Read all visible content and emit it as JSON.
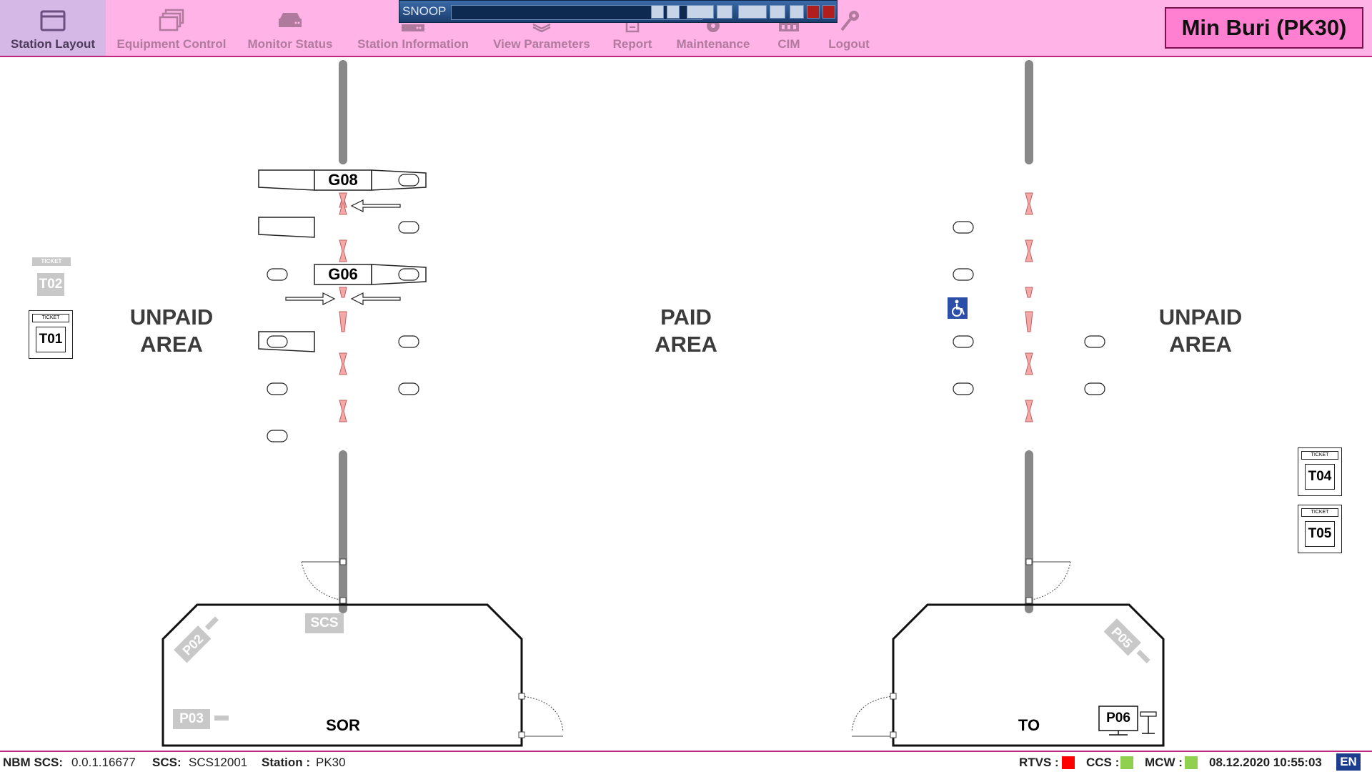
{
  "toolbar": {
    "items": [
      {
        "label": "Station Layout",
        "icon": "window-icon",
        "active": true
      },
      {
        "label": "Equipment Control",
        "icon": "windows-stack-icon"
      },
      {
        "label": "Monitor Status",
        "icon": "server-icon"
      },
      {
        "label": "Station Information",
        "icon": "info-server-icon"
      },
      {
        "label": "View Parameters",
        "icon": "layers-icon"
      },
      {
        "label": "Report",
        "icon": "document-icon"
      },
      {
        "label": "Maintenance",
        "icon": "gear-icon"
      },
      {
        "label": "CIM",
        "icon": "cim-icon"
      },
      {
        "label": "Logout",
        "icon": "key-icon"
      }
    ],
    "station_name": "Min Buri (PK30)"
  },
  "snoop": {
    "title": "SNOOP"
  },
  "layout": {
    "areas": {
      "left": [
        "UNPAID",
        "AREA"
      ],
      "center": [
        "PAID",
        "AREA"
      ],
      "right": [
        "UNPAID",
        "AREA"
      ]
    },
    "gates": {
      "g08": "G08",
      "g06": "G06"
    },
    "tvms": {
      "t01": {
        "id": "T01",
        "header": "TICKET"
      },
      "t02": {
        "id": "T02",
        "header": "TICKET"
      },
      "t04": {
        "id": "T04",
        "header": "TICKET"
      },
      "t05": {
        "id": "T05",
        "header": "TICKET"
      }
    },
    "rooms": {
      "left": {
        "name": "SOR",
        "scs": "SCS",
        "p02": "P02",
        "p03": "P03"
      },
      "right": {
        "name": "TO",
        "p05": "P05",
        "p06": "P06"
      }
    }
  },
  "status": {
    "nbm_label": "NBM SCS:",
    "nbm_value": "0.0.1.16677",
    "scs_label": "SCS:",
    "scs_value": "SCS12001",
    "station_label": "Station :",
    "station_value": "PK30",
    "rtvs_label": "RTVS :",
    "rtvs_color": "#ff0000",
    "ccs_label": "CCS :",
    "ccs_color": "#8fd14f",
    "mcw_label": "MCW :",
    "mcw_color": "#8fd14f",
    "datetime": "08.12.2020 10:55:03",
    "lang": "EN"
  }
}
